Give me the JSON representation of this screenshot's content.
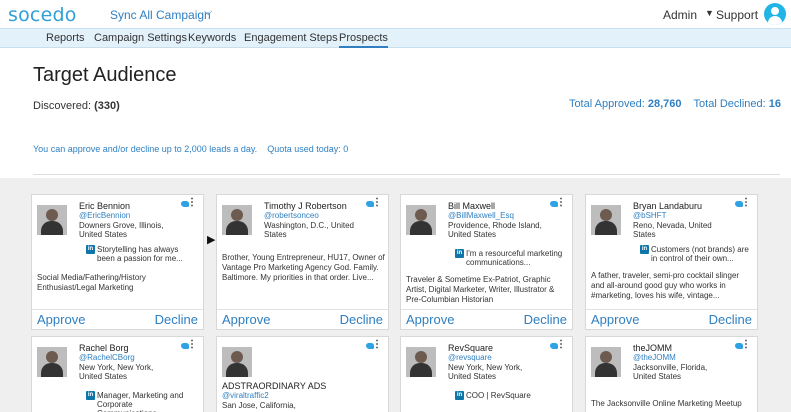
{
  "header": {
    "logo": "socedo",
    "campaign_selector": "Sync All Campaign",
    "admin_menu": "Admin",
    "support_link": "Support"
  },
  "nav": {
    "items": [
      "Reports",
      "Campaign Settings",
      "Keywords",
      "Engagement Steps",
      "Prospects"
    ],
    "active": "Prospects"
  },
  "page": {
    "title": "Target Audience",
    "discovered_label": "Discovered:",
    "discovered_value": "(330)",
    "total_approved_label": "Total Approved:",
    "total_approved_value": "28,760",
    "total_declined_label": "Total Declined:",
    "total_declined_value": "16",
    "quota_text": "You can approve and/or decline up to 2,000 leads a day.",
    "quota_used": "Quota used today: 0"
  },
  "card_actions": {
    "approve": "Approve",
    "decline": "Decline"
  },
  "cards": [
    {
      "name": "Eric Bennion",
      "handle": "@EricBennion",
      "location": "Downers Grove, Illinois, United States",
      "job": "Storytelling has always been a passion for me...",
      "bio": "Social Media/Fathering/History Enthusiast/Legal Marketing"
    },
    {
      "name": "Timothy J Robertson",
      "handle": "@robertsonceo",
      "location": "Washington, D.C., United States",
      "job": "",
      "bio": "Brother, Young Entrepreneur, HU17, Owner of Vantage Pro Marketing Agency God. Family. Baltimore. My priorities in that order. Live..."
    },
    {
      "name": "Bill Maxwell",
      "handle": "@BillMaxwell_Esq",
      "location": "Providence, Rhode Island, United States",
      "job": "I'm a resourceful marketing communications...",
      "bio": "Traveler & Sometime Ex-Patriot, Graphic Artist, Digital Marketer, Writer, Illustrator & Pre-Columbian Historian"
    },
    {
      "name": "Bryan Landaburu",
      "handle": "@bSHFT",
      "location": "Reno, Nevada, United States",
      "job": "Customers (not brands) are in control of their own...",
      "bio": "A father, traveler, semi-pro cocktail slinger and all-around good guy who works in #marketing, loves his wife, vintage..."
    },
    {
      "name": "Rachel Borg",
      "handle": "@RachelCBorg",
      "location": "New York, New York, United States",
      "job": "Manager, Marketing and Corporate Communications...",
      "bio": ""
    },
    {
      "name": "ADSTRAORDINARY ADS",
      "handle": "@viraltraffic2",
      "location": "San Jose, California,",
      "job": "",
      "bio": ""
    },
    {
      "name": "RevSquare",
      "handle": "@revsquare",
      "location": "New York, New York, United States",
      "job": "COO | RevSquare",
      "bio": ""
    },
    {
      "name": "theJOMM",
      "handle": "@theJOMM",
      "location": "Jacksonville, Florida, United States",
      "job": "",
      "bio": "The Jacksonville Online Marketing Meetup"
    }
  ]
}
